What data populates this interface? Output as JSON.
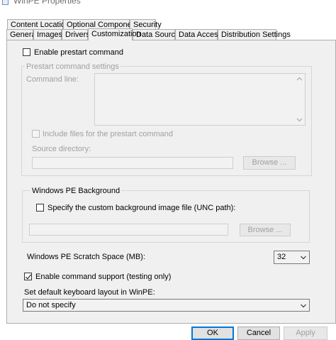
{
  "window": {
    "title": "WinPE Properties"
  },
  "tabs_row1": [
    {
      "label": "Content Locations"
    },
    {
      "label": "Optional Components"
    },
    {
      "label": "Security"
    }
  ],
  "tabs_row2": [
    {
      "label": "General"
    },
    {
      "label": "Images"
    },
    {
      "label": "Drivers"
    },
    {
      "label": "Customization",
      "active": true
    },
    {
      "label": "Data Source"
    },
    {
      "label": "Data Access"
    },
    {
      "label": "Distribution Settings"
    }
  ],
  "prestart": {
    "enable_label": "Enable prestart command",
    "enabled": false,
    "group_label": "Prestart command settings",
    "command_line_label": "Command line:",
    "command_line_value": "",
    "include_files_label": "Include files for the prestart command",
    "source_dir_label": "Source directory:",
    "source_dir_value": "",
    "browse_label": "Browse ..."
  },
  "background": {
    "group_label": "Windows PE Background",
    "specify_label": "Specify the custom background image file (UNC path):",
    "path_value": "",
    "browse_label": "Browse ..."
  },
  "scratch": {
    "label": "Windows PE Scratch Space (MB):",
    "value": "32"
  },
  "command_support": {
    "label": "Enable command support (testing only)",
    "checked": true
  },
  "keyboard": {
    "label": "Set default keyboard layout in WinPE:",
    "value": "Do not specify"
  },
  "buttons": {
    "ok": "OK",
    "cancel": "Cancel",
    "apply": "Apply"
  }
}
